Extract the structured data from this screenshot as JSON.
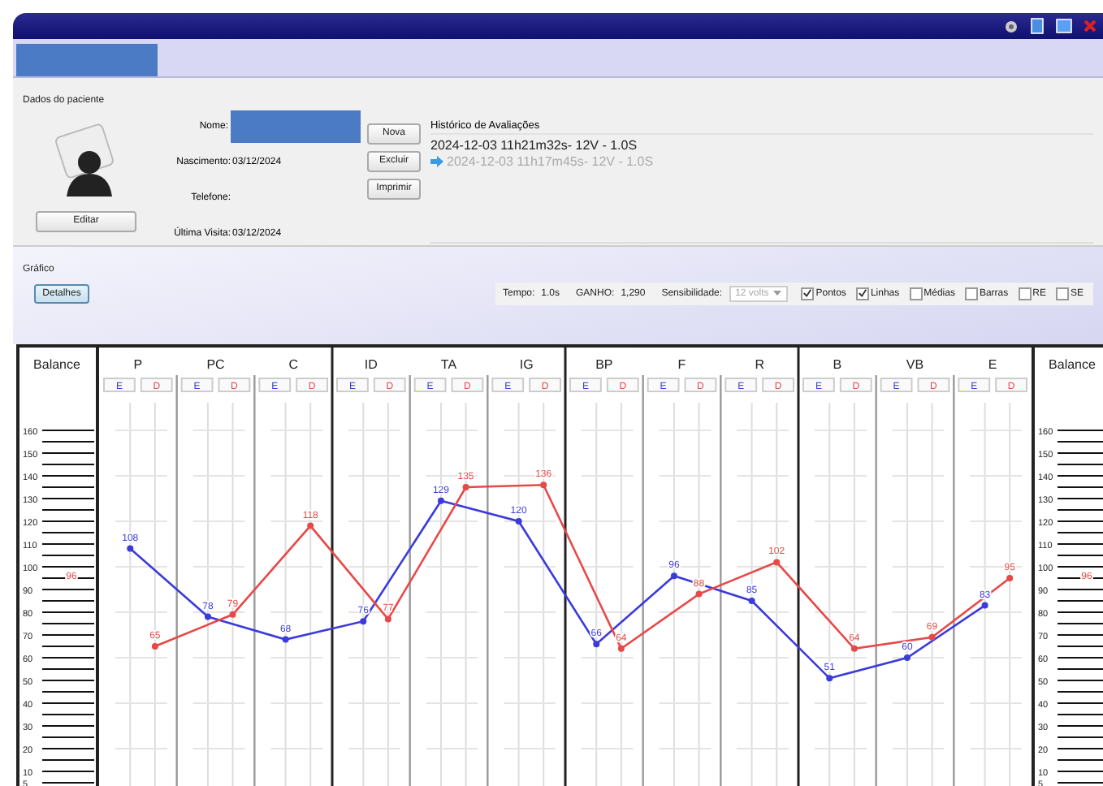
{
  "patient": {
    "group_title": "Dados do paciente",
    "fields": [
      {
        "label": "Nome:",
        "kind": "redacted"
      },
      {
        "label": "Nascimento:",
        "value": "03/12/2024",
        "kind": "text"
      },
      {
        "label": "Telefone:",
        "kind": "text"
      },
      {
        "label": "Última Visita:",
        "value": "03/12/2024",
        "kind": "text"
      }
    ],
    "edit_button": "Editar"
  },
  "actions": [
    "Nova",
    "Excluir",
    "Imprimir"
  ],
  "history": {
    "title": "Histórico de Avaliações",
    "items": [
      {
        "text": "2024-12-03 11h21m32s- 12V - 1.0S",
        "selected": true
      },
      {
        "text": "2024-12-03 11h17m45s- 12V - 1.0S",
        "selected": false
      }
    ]
  },
  "graph_bar": {
    "title": "Gráfico",
    "details_button": "Detalhes",
    "tempo_label": "Tempo:",
    "tempo": "1.0s",
    "ganho_label": "GANHO:",
    "ganho": "1,290",
    "sens_label": "Sensibilidade:",
    "sens_value": "12 volts",
    "options": [
      {
        "label": "Pontos",
        "checked": true
      },
      {
        "label": "Linhas",
        "checked": true
      },
      {
        "label": "Médias",
        "checked": false
      },
      {
        "label": "Barras",
        "checked": false
      },
      {
        "label": "RE",
        "checked": false
      },
      {
        "label": "SE",
        "checked": false
      }
    ]
  },
  "balance": [
    {
      "title": "Balance",
      "ticks": [
        "160",
        "150",
        "140",
        "130",
        "120",
        "110",
        "100",
        "90",
        "80",
        "70",
        "60",
        "50",
        "40",
        "30",
        "20",
        "10",
        "5"
      ],
      "marker": "96"
    },
    {
      "title": "Balance",
      "ticks": [
        "160",
        "150",
        "140",
        "130",
        "120",
        "110",
        "100",
        "90",
        "80",
        "70",
        "60",
        "50",
        "40",
        "30",
        "20",
        "10",
        "5"
      ],
      "marker": "96"
    }
  ],
  "chart_data": {
    "type": "line",
    "categories": [
      "P",
      "PC",
      "C",
      "ID",
      "TA",
      "IG",
      "BP",
      "F",
      "R",
      "B",
      "VB",
      "E"
    ],
    "data_labels": true,
    "series": [
      {
        "name": "E",
        "color": "#3b3bdc",
        "marker": "o",
        "values": [
          108,
          78,
          68,
          76,
          129,
          120,
          66,
          96,
          85,
          51,
          60,
          83
        ]
      },
      {
        "name": "D",
        "color": "#e84848",
        "marker": "o",
        "values": [
          65,
          79,
          118,
          77,
          135,
          136,
          64,
          88,
          102,
          64,
          69,
          95
        ]
      }
    ]
  }
}
